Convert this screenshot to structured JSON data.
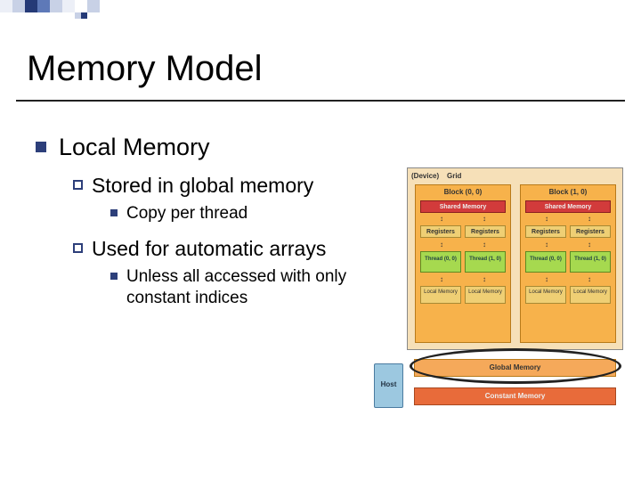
{
  "slide": {
    "title": "Memory Model",
    "l1": {
      "text": "Local Memory"
    },
    "l2a": {
      "text": "Stored in global memory"
    },
    "l3a": {
      "text": "Copy per thread"
    },
    "l2b": {
      "text": "Used for automatic arrays"
    },
    "l3b": {
      "text": "Unless all accessed with only constant indices"
    }
  },
  "diagram": {
    "device": "(Device)",
    "grid": "Grid",
    "block0": "Block (0, 0)",
    "block1": "Block (1, 0)",
    "shared": "Shared Memory",
    "registers": "Registers",
    "thread00": "Thread (0, 0)",
    "thread10": "Thread (1, 0)",
    "local": "Local Memory",
    "host": "Host",
    "global": "Global Memory",
    "constant": "Constant Memory"
  }
}
